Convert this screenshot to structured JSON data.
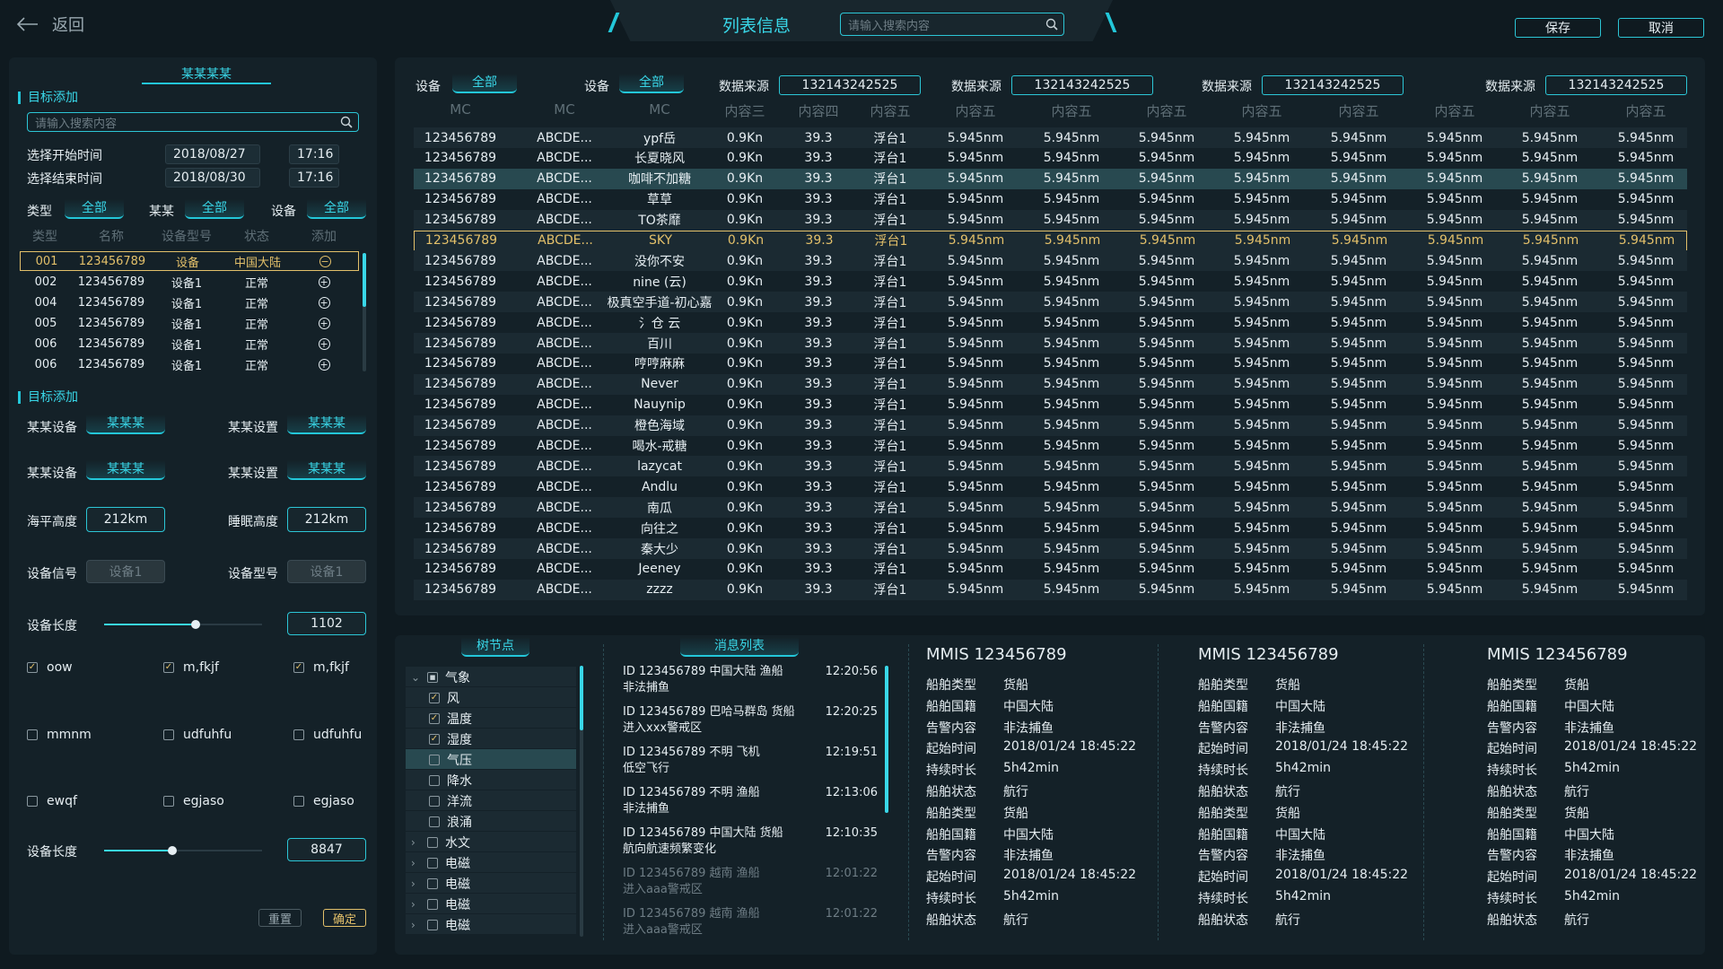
{
  "header": {
    "back_label": "返回",
    "title": "列表信息",
    "search_placeholder": "请输入搜索内容",
    "save_label": "保存",
    "cancel_label": "取消"
  },
  "left": {
    "title": "某某某某",
    "section1": "目标添加",
    "search_placeholder": "请输入搜索内容",
    "start_label": "选择开始时间",
    "start_date": "2018/08/27",
    "start_time": "17:16",
    "end_label": "选择结束时间",
    "end_date": "2018/08/30",
    "end_time": "17:16",
    "filters": [
      {
        "label": "类型",
        "value": "全部"
      },
      {
        "label": "某某",
        "value": "全部"
      },
      {
        "label": "设备",
        "value": "全部"
      }
    ],
    "table_headers": [
      "类型",
      "名称",
      "设备型号",
      "状态",
      "添加"
    ],
    "table_rows": [
      {
        "c1": "001",
        "c2": "123456789",
        "c3": "设备",
        "c4": "中国大陆",
        "icon": "−"
      },
      {
        "c1": "002",
        "c2": "123456789",
        "c3": "设备1",
        "c4": "正常",
        "icon": "+"
      },
      {
        "c1": "004",
        "c2": "123456789",
        "c3": "设备1",
        "c4": "正常",
        "icon": "+"
      },
      {
        "c1": "005",
        "c2": "123456789",
        "c3": "设备1",
        "c4": "正常",
        "icon": "+"
      },
      {
        "c1": "006",
        "c2": "123456789",
        "c3": "设备1",
        "c4": "正常",
        "icon": "+"
      },
      {
        "c1": "006",
        "c2": "123456789",
        "c3": "设备1",
        "c4": "正常",
        "icon": "+"
      }
    ],
    "section2": "目标添加",
    "pairs": [
      {
        "l1": "某某设备",
        "v1": "某某某",
        "l2": "某某设置",
        "v2": "某某某"
      },
      {
        "l1": "某某设备",
        "v1": "某某某",
        "l2": "某某设置",
        "v2": "某某某"
      }
    ],
    "altitude_label": "海平高度",
    "altitude_value": "212km",
    "sleep_label": "睡眠高度",
    "sleep_value": "212km",
    "signal_label": "设备信号",
    "signal_value": "设备1",
    "model_label": "设备型号",
    "model_value": "设备1",
    "length1_label": "设备长度",
    "length1_value": "1102",
    "length1_fraction": 0.58,
    "length2_label": "设备长度",
    "length2_value": "8847",
    "length2_fraction": 0.43,
    "checks": [
      {
        "label": "oow",
        "checked": true
      },
      {
        "label": "m,fkjf",
        "checked": true
      },
      {
        "label": "m,fkjf",
        "checked": true
      },
      {
        "label": "mmnm",
        "checked": false
      },
      {
        "label": "udfuhfu",
        "checked": false
      },
      {
        "label": "udfuhfu",
        "checked": false
      },
      {
        "label": "ewqf",
        "checked": false
      },
      {
        "label": "egjaso",
        "checked": false
      },
      {
        "label": "egjaso",
        "checked": false
      }
    ],
    "reset_label": "重置",
    "confirm_label": "确定"
  },
  "main": {
    "filter1_label": "设备",
    "filter1_value": "全部",
    "filter2_label": "设备",
    "filter2_value": "全部",
    "sources": [
      {
        "label": "数据来源",
        "value": "132143242525"
      },
      {
        "label": "数据来源",
        "value": "132143242525"
      },
      {
        "label": "数据来源",
        "value": "132143242525"
      },
      {
        "label": "数据来源",
        "value": "132143242525"
      }
    ],
    "headers": [
      "MC",
      "MC",
      "MC",
      "内容三",
      "内容四",
      "内容五",
      "内容五",
      "内容五",
      "内容五",
      "内容五",
      "内容五",
      "内容五",
      "内容五",
      "内容五"
    ],
    "names": [
      "ypf岳",
      "长夏晓风",
      "咖啡不加糖",
      "草草",
      "TO茶靡",
      "SKY",
      "没你不安",
      "nine (云)",
      "极真空手道-初心嘉",
      "氵仓 云",
      "百川",
      "哼哼麻麻",
      "Never",
      "Nauynip",
      "橙色海域",
      "喝水-戒糖",
      "lazycat",
      "Andlu",
      "南瓜",
      "向往之",
      "秦大少",
      "Jeeney",
      "zzzz"
    ],
    "col1": "123456789",
    "col2": "ABCDE...",
    "col4": "0.9Kn",
    "col5": "39.3",
    "col6": "浮台1",
    "colN": "5.945nm"
  },
  "tree": {
    "title": "树节点",
    "items": [
      {
        "label": "气象",
        "level": 0,
        "chev": "⌄",
        "checked": "partial"
      },
      {
        "label": "风",
        "level": 1,
        "checked": true
      },
      {
        "label": "温度",
        "level": 1,
        "checked": true
      },
      {
        "label": "湿度",
        "level": 1,
        "checked": true
      },
      {
        "label": "气压",
        "level": 1,
        "checked": false
      },
      {
        "label": "降水",
        "level": 1,
        "checked": false
      },
      {
        "label": "洋流",
        "level": 1,
        "checked": false
      },
      {
        "label": "浪涌",
        "level": 1,
        "checked": false
      },
      {
        "label": "水文",
        "level": 0,
        "chev": "›",
        "checked": false
      },
      {
        "label": "电磁",
        "level": 0,
        "chev": "›",
        "checked": false
      },
      {
        "label": "电磁",
        "level": 0,
        "chev": "›",
        "checked": false
      },
      {
        "label": "电磁",
        "level": 0,
        "chev": "›",
        "checked": false
      },
      {
        "label": "电磁",
        "level": 0,
        "chev": "›",
        "checked": false
      }
    ]
  },
  "messages": {
    "title": "消息列表",
    "items": [
      {
        "line1": "ID 123456789  中国大陆  渔船",
        "line2": "非法捕鱼",
        "time": "12:20:56"
      },
      {
        "line1": "ID 123456789  巴哈马群岛  货船",
        "line2": "进入xxx警戒区",
        "time": "12:20:25"
      },
      {
        "line1": "ID 123456789  不明  飞机",
        "line2": "低空飞行",
        "time": "12:19:51"
      },
      {
        "line1": "ID 123456789  不明  渔船",
        "line2": "非法捕鱼",
        "time": "12:13:06"
      },
      {
        "line1": "ID 123456789  中国大陆  货船",
        "line2": "航向航速频繁变化",
        "time": "12:10:35"
      },
      {
        "line1": "ID 123456789  越南  渔船",
        "line2": "进入aaa警戒区",
        "time": "12:01:22"
      },
      {
        "line1": "ID 123456789  越南  渔船",
        "line2": "进入aaa警戒区",
        "time": "12:01:22"
      }
    ]
  },
  "cards": [
    {
      "title": "MMIS  123456789",
      "rows": [
        {
          "k": "船舶类型",
          "v": "货船"
        },
        {
          "k": "船舶国籍",
          "v": "中国大陆"
        },
        {
          "k": "告警内容",
          "v": "非法捕鱼"
        },
        {
          "k": "起始时间",
          "v": "2018/01/24 18:45:22"
        },
        {
          "k": "持续时长",
          "v": "5h42min"
        },
        {
          "k": "船舶状态",
          "v": "航行"
        },
        {
          "k": "船舶类型",
          "v": "货船"
        },
        {
          "k": "船舶国籍",
          "v": "中国大陆"
        },
        {
          "k": "告警内容",
          "v": "非法捕鱼"
        },
        {
          "k": "起始时间",
          "v": "2018/01/24 18:45:22"
        },
        {
          "k": "持续时长",
          "v": "5h42min"
        },
        {
          "k": "船舶状态",
          "v": "航行"
        }
      ]
    },
    {
      "title": "MMIS  123456789",
      "rows": [
        {
          "k": "船舶类型",
          "v": "货船"
        },
        {
          "k": "船舶国籍",
          "v": "中国大陆"
        },
        {
          "k": "告警内容",
          "v": "非法捕鱼"
        },
        {
          "k": "起始时间",
          "v": "2018/01/24 18:45:22"
        },
        {
          "k": "持续时长",
          "v": "5h42min"
        },
        {
          "k": "船舶状态",
          "v": "航行"
        },
        {
          "k": "船舶类型",
          "v": "货船"
        },
        {
          "k": "船舶国籍",
          "v": "中国大陆"
        },
        {
          "k": "告警内容",
          "v": "非法捕鱼"
        },
        {
          "k": "起始时间",
          "v": "2018/01/24 18:45:22"
        },
        {
          "k": "持续时长",
          "v": "5h42min"
        },
        {
          "k": "船舶状态",
          "v": "航行"
        }
      ]
    },
    {
      "title": "MMIS  123456789",
      "rows": [
        {
          "k": "船舶类型",
          "v": "货船"
        },
        {
          "k": "船舶国籍",
          "v": "中国大陆"
        },
        {
          "k": "告警内容",
          "v": "非法捕鱼"
        },
        {
          "k": "起始时间",
          "v": "2018/01/24 18:45:22"
        },
        {
          "k": "持续时长",
          "v": "5h42min"
        },
        {
          "k": "船舶状态",
          "v": "航行"
        },
        {
          "k": "船舶类型",
          "v": "货船"
        },
        {
          "k": "船舶国籍",
          "v": "中国大陆"
        },
        {
          "k": "告警内容",
          "v": "非法捕鱼"
        },
        {
          "k": "起始时间",
          "v": "2018/01/24 18:45:22"
        },
        {
          "k": "持续时长",
          "v": "5h42min"
        },
        {
          "k": "船舶状态",
          "v": "航行"
        }
      ]
    }
  ],
  "colors": {
    "background": "#0f1a20",
    "panel": "#142128",
    "accent": "#39d7e8",
    "highlight": "#e3c06a",
    "row_selected_bg": "#284950"
  },
  "icons": {
    "back": "arrow-left-icon",
    "search": "search-icon",
    "add": "plus-circle-icon",
    "remove": "minus-circle-icon",
    "check": "checkbox-icon",
    "expand": "chevron-icon"
  }
}
